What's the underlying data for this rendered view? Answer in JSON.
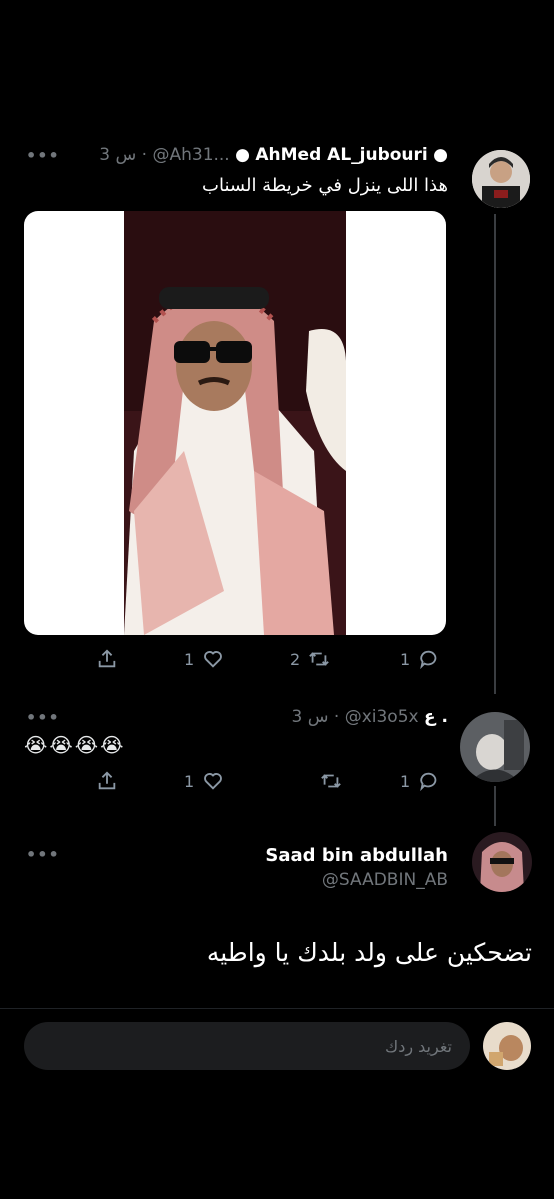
{
  "tweet1": {
    "display_name": "AhMed AL_jubouri",
    "handle": "@Ah31...",
    "time": "3 س",
    "text": "هذا اللى ينزل في خريطة السناب",
    "actions": {
      "replies": "1",
      "retweets": "2",
      "likes": "1"
    },
    "avatar_icon": "user-avatar-icon",
    "verified_icon": "apple-icon"
  },
  "tweet2": {
    "display_name": "ع .",
    "handle": "@xi3o5x",
    "time": "3 س",
    "text": "😭😭😭😭",
    "actions": {
      "replies": "1",
      "retweets": "",
      "likes": "1"
    }
  },
  "main_tweet": {
    "display_name": "Saad bin abdullah",
    "handle": "@SAADBIN_AB",
    "text": "تضحكين على ولد بلدك يا واطيه"
  },
  "reply": {
    "placeholder": "تغريد ردك"
  },
  "icons": {
    "reply": "reply-icon",
    "retweet": "retweet-icon",
    "like": "heart-icon",
    "share": "share-icon",
    "more": "more-icon"
  },
  "colors": {
    "background": "#000000",
    "muted": "#71767b",
    "thread_line": "#3a3d41"
  }
}
